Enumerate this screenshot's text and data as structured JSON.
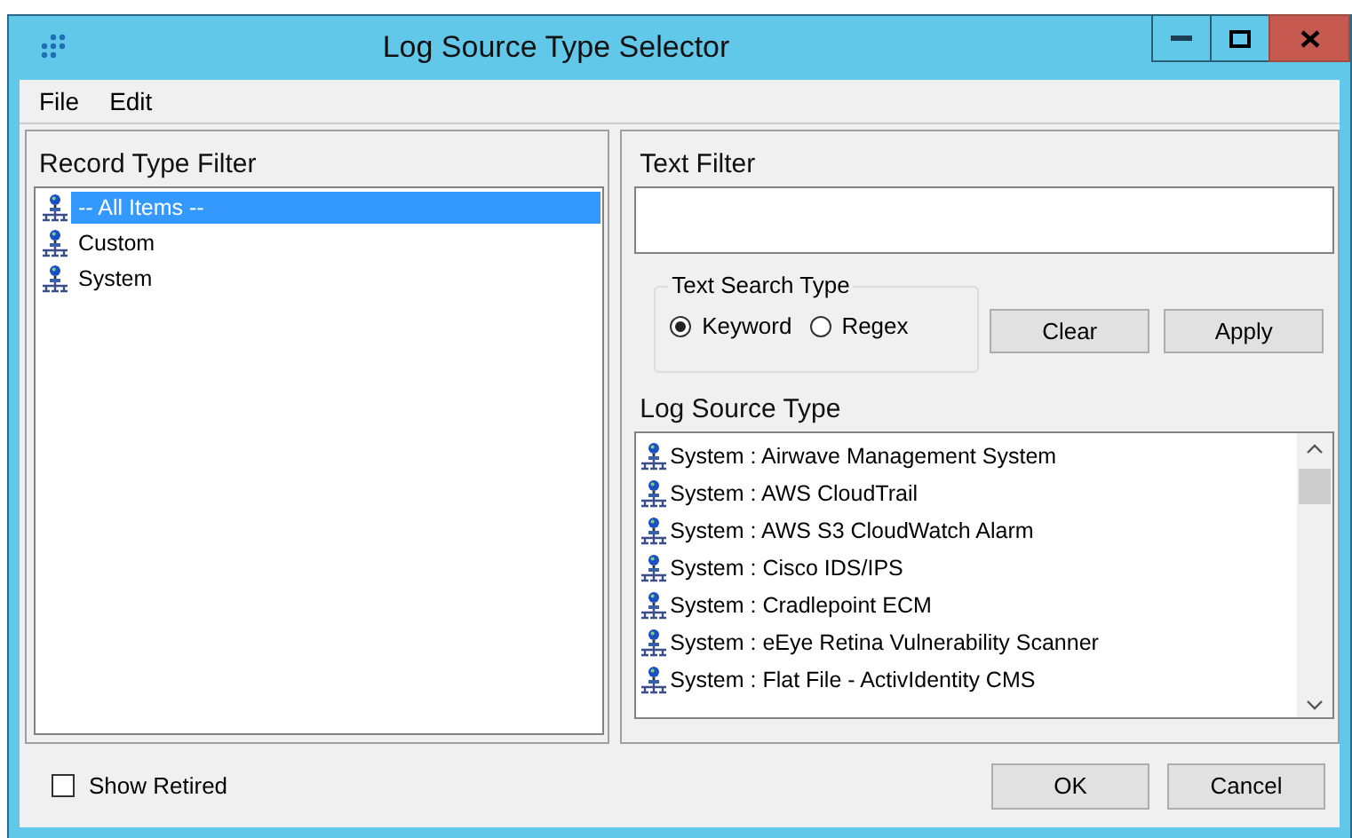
{
  "window": {
    "title": "Log Source Type Selector"
  },
  "menu": [
    "File",
    "Edit"
  ],
  "record_type_filter": {
    "title": "Record Type Filter",
    "items": [
      {
        "label": "-- All Items --",
        "selected": true
      },
      {
        "label": "Custom",
        "selected": false
      },
      {
        "label": "System",
        "selected": false
      }
    ]
  },
  "text_filter": {
    "title": "Text Filter"
  },
  "text_search_type": {
    "title": "Text Search Type",
    "options": [
      {
        "label": "Keyword",
        "selected": true
      },
      {
        "label": "Regex",
        "selected": false
      }
    ]
  },
  "filter_buttons": [
    "Clear",
    "Apply"
  ],
  "log_source_type": {
    "title": "Log Source Type",
    "items": [
      "System : Airwave Management System",
      "System : AWS CloudTrail",
      "System : AWS S3 CloudWatch Alarm",
      "System : Cisco IDS/IPS",
      "System : Cradlepoint ECM",
      "System : eEye Retina Vulnerability Scanner",
      "System : Flat File - ActivIdentity CMS"
    ]
  },
  "show_retired": {
    "label": "Show Retired",
    "checked": false
  },
  "buttons": [
    "OK",
    "Cancel"
  ]
}
